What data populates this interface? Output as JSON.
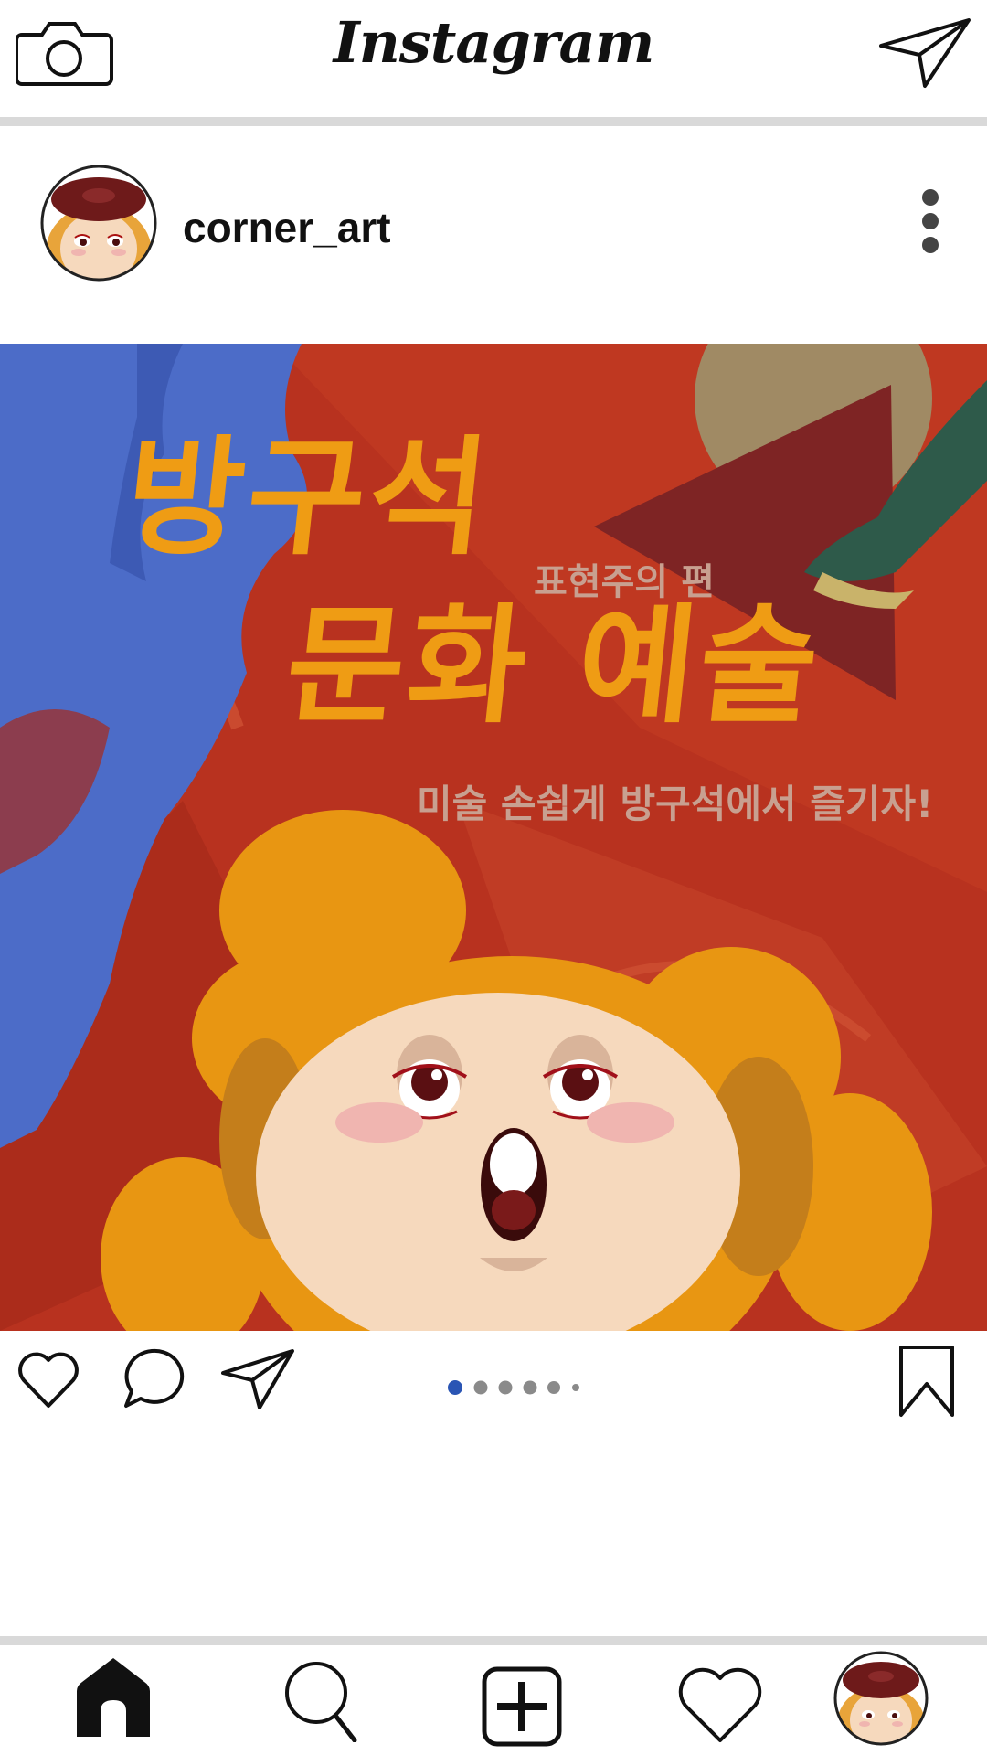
{
  "header": {
    "logo": "Instagram",
    "icons": [
      "camera-icon",
      "direct-message-icon"
    ]
  },
  "post": {
    "username": "corner_art",
    "image": {
      "title_line1": "방구석",
      "subtitle": "표현주의 편",
      "title_line2": "문화 예술",
      "tagline": "미술 손쉽게 방구석에서 즐기자!"
    },
    "carousel": {
      "total_dots": 6,
      "active_index": 0
    },
    "actions": [
      "heart-icon",
      "comment-icon",
      "share-icon",
      "bookmark-icon"
    ]
  },
  "bottom_nav": {
    "items": [
      "home-icon",
      "search-icon",
      "add-post-icon",
      "activity-heart-icon",
      "profile-avatar"
    ]
  },
  "colors": {
    "accent_orange": "#ef9c14",
    "painting_red": "#b8321f",
    "painting_blue": "#4c6cc8",
    "active_dot": "#2a55b4",
    "inactive_dot": "#8a8a8a"
  }
}
